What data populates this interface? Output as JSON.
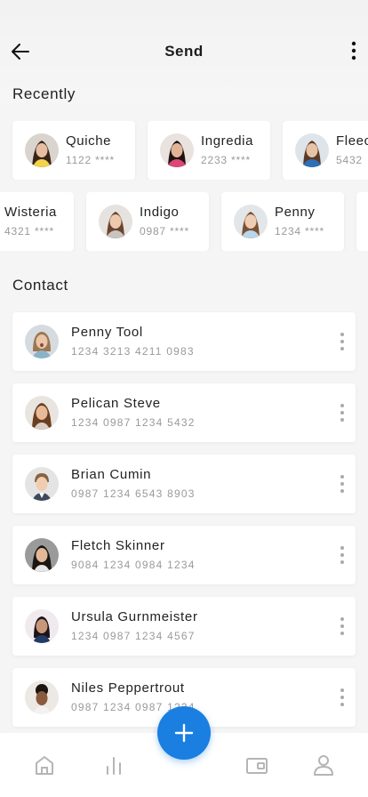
{
  "header": {
    "title": "Send",
    "back_icon": "arrow-left-icon",
    "more_icon": "more-vertical-icon"
  },
  "recently": {
    "label": "Recently",
    "row1": [
      {
        "name": "Quiche",
        "number": "1122 ****"
      },
      {
        "name": "Ingredia",
        "number": "2233 ****"
      },
      {
        "name": "Fleec",
        "number": "5432"
      }
    ],
    "row2": [
      {
        "name": "Wisteria",
        "number": "4321 ****"
      },
      {
        "name": "Indigo",
        "number": "0987 ****"
      },
      {
        "name": "Penny",
        "number": "1234 ****"
      }
    ]
  },
  "contacts": {
    "label": "Contact",
    "items": [
      {
        "name": "Penny Tool",
        "number": "1234 3213 4211 0983"
      },
      {
        "name": "Pelican Steve",
        "number": "1234 0987 1234 5432"
      },
      {
        "name": "Brian Cumin",
        "number": "0987 1234 6543 8903"
      },
      {
        "name": "Fletch Skinner",
        "number": "9084 1234 0984 1234"
      },
      {
        "name": "Ursula Gurnmeister",
        "number": "1234 0987 1234 4567"
      },
      {
        "name": "Niles Peppertrout",
        "number": "0987 1234 0987 1234"
      }
    ]
  },
  "bottom_nav": {
    "items": [
      "home-icon",
      "stats-icon",
      "wallet-icon",
      "profile-icon"
    ],
    "fab_icon": "plus-icon"
  },
  "colors": {
    "accent": "#1a7fe0",
    "background": "#f5f5f5",
    "muted_text": "#9a9a9a"
  }
}
